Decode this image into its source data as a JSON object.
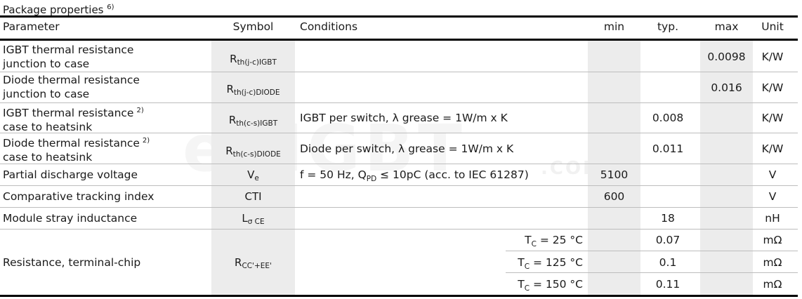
{
  "title": "Package properties",
  "title_note": "6)",
  "headers": {
    "parameter": "Parameter",
    "symbol": "Symbol",
    "conditions": "Conditions",
    "min": "min",
    "typ": "typ.",
    "max": "max",
    "unit": "Unit"
  },
  "rows": [
    {
      "param_line1": "IGBT thermal resistance",
      "param_line2": "junction to case",
      "note": "",
      "sym_main": "R",
      "sym_sub": "th(j-c)IGBT",
      "cond": "",
      "min": "",
      "typ": "",
      "max": "0.0098",
      "unit": "K/W"
    },
    {
      "param_line1": "Diode thermal resistance",
      "param_line2": "junction to case",
      "note": "",
      "sym_main": "R",
      "sym_sub": "th(j-c)DIODE",
      "cond": "",
      "min": "",
      "typ": "",
      "max": "0.016",
      "unit": "K/W"
    },
    {
      "param_line1": "IGBT thermal resistance",
      "param_line2": "case to heatsink",
      "note": "2)",
      "sym_main": "R",
      "sym_sub": "th(c-s)IGBT",
      "cond": "IGBT per switch, λ grease = 1W/m x K",
      "min": "",
      "typ": "0.008",
      "max": "",
      "unit": "K/W"
    },
    {
      "param_line1": "Diode thermal resistance",
      "param_line2": "case to heatsink",
      "note": "2)",
      "sym_main": "R",
      "sym_sub": "th(c-s)DIODE",
      "cond": "Diode per switch, λ grease = 1W/m x K",
      "min": "",
      "typ": "0.011",
      "max": "",
      "unit": "K/W"
    },
    {
      "param_line1": "Partial discharge voltage",
      "param_line2": "",
      "note": "",
      "sym_main": "V",
      "sym_sub": "e",
      "cond_a": "f = 50 Hz, Q",
      "cond_sub": "PD",
      "cond_b": " ≤ 10pC (acc. to IEC 61287)",
      "min": "5100",
      "typ": "",
      "max": "",
      "unit": "V"
    },
    {
      "param_line1": "Comparative tracking index",
      "param_line2": "",
      "note": "",
      "sym_main": "CTI",
      "sym_sub": "",
      "cond": "",
      "min": "600",
      "typ": "",
      "max": "",
      "unit": "V"
    },
    {
      "param_line1": "Module stray inductance",
      "param_line2": "",
      "note": "",
      "sym_main": "L",
      "sym_sub": "σ CE",
      "cond": "",
      "min": "",
      "typ": "18",
      "max": "",
      "unit": "nH"
    }
  ],
  "resistance": {
    "param": "Resistance, terminal-chip",
    "sym_main": "R",
    "sym_sub": "CC'+EE'",
    "subrows": [
      {
        "cond_main": "T",
        "cond_sub": "C",
        "cond_val": " = 25 °C",
        "typ": "0.07",
        "unit": "mΩ"
      },
      {
        "cond_main": "T",
        "cond_sub": "C",
        "cond_val": " = 125 °C",
        "typ": "0.1",
        "unit": "mΩ"
      },
      {
        "cond_main": "T",
        "cond_sub": "C",
        "cond_val": " = 150 °C",
        "typ": "0.11",
        "unit": "mΩ"
      }
    ]
  }
}
